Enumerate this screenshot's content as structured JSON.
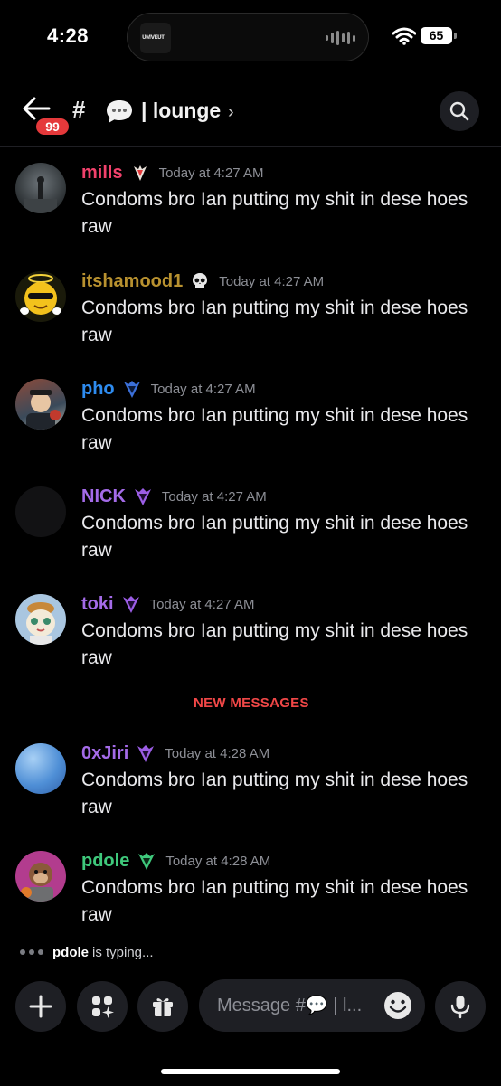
{
  "status": {
    "time": "4:28",
    "battery": "65",
    "now_playing_art_text": "ᴜᴍᴠᴇᴜᴛ"
  },
  "header": {
    "unread_badge": "99",
    "hash": "#",
    "channel_name": "| lounge",
    "chevron": "›"
  },
  "messages": [
    {
      "username": "mills",
      "color": "#f0416b",
      "role_icon": "crest-badge-icon",
      "timestamp": "Today at 4:27 AM",
      "text": "Condoms bro Ian putting my shit in dese hoes raw"
    },
    {
      "username": "itshamood1",
      "color": "#b8912f",
      "role_icon": "skull-icon",
      "timestamp": "Today at 4:27 AM",
      "text": "Condoms bro Ian putting my shit in dese hoes raw"
    },
    {
      "username": "pho",
      "color": "#2e8cf0",
      "role_icon": "shield-badge-icon",
      "timestamp": "Today at 4:27 AM",
      "text": "Condoms bro Ian putting my shit in dese hoes raw"
    },
    {
      "username": "NICK",
      "color": "#a46be8",
      "role_icon": "shield-badge-icon",
      "timestamp": "Today at 4:27 AM",
      "text": "Condoms bro Ian putting my shit in dese hoes raw"
    },
    {
      "username": "toki",
      "color": "#a46be8",
      "role_icon": "shield-badge-icon",
      "timestamp": "Today at 4:27 AM",
      "text": "Condoms bro Ian putting my shit in dese hoes raw"
    },
    {
      "username": "0xJiri",
      "color": "#a46be8",
      "role_icon": "shield-badge-icon",
      "timestamp": "Today at 4:28 AM",
      "text": "Condoms bro Ian putting my shit in dese hoes raw"
    },
    {
      "username": "pdole",
      "color": "#3fc97c",
      "role_icon": "shield-badge-icon",
      "timestamp": "Today at 4:28 AM",
      "text": "Condoms bro Ian putting my shit in dese hoes raw"
    }
  ],
  "divider_label": "NEW MESSAGES",
  "typing": {
    "user": "pdole",
    "suffix": "is typing..."
  },
  "composer": {
    "placeholder": "Message #💬 | l..."
  },
  "colors": {
    "background": "#000000",
    "surface": "#1e1f24",
    "new_messages": "#f04747",
    "badge": "#e5393b"
  }
}
